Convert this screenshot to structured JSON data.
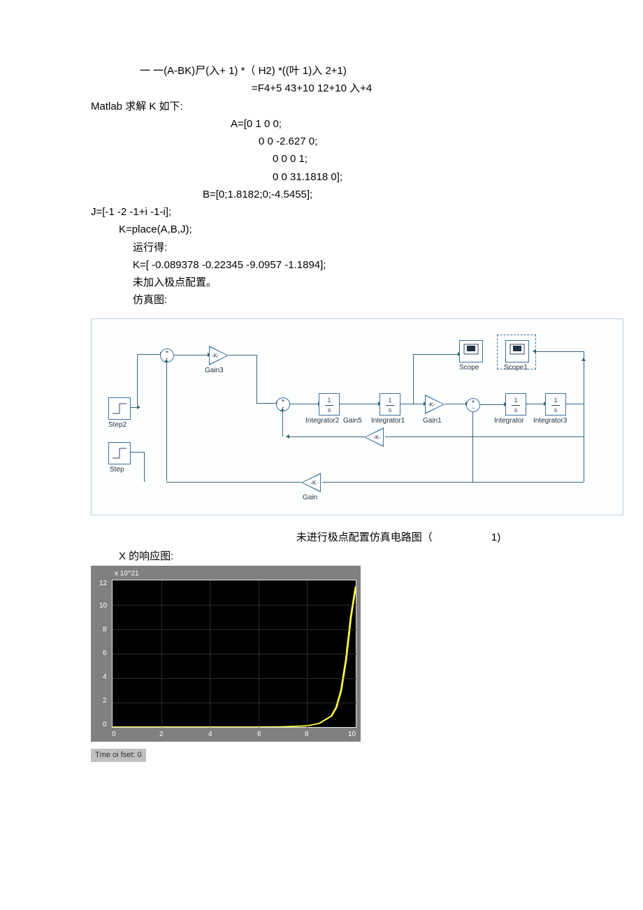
{
  "equations": {
    "line1": "一 一(A-BK)尸(入+ 1) *（ H2) *((叶 1)入 2+1)",
    "line2": "=F4+5 43+10 12+10 入+4"
  },
  "matlab_heading": "Matlab 求解 K 如下:",
  "matlab_lines": {
    "a0": "A=[0     1       0            0;",
    "a1": "0     0 -2.627        0;",
    "a2": "0 0        0          1;",
    "a3": "0 0 31.1818             0];",
    "b": "B=[0;1.8182;0;-4.5455];"
  },
  "j_line": "J=[-1 -2 -1+i     -1-i];",
  "k_line": "K=place(A,B,J);",
  "run_label": "运行得:",
  "k_result": "K=[ -0.089378       -0.22345 -9.0957 -1.1894];",
  "no_pole": "未加入极点配置。",
  "sim_label": "仿真图:",
  "diagram": {
    "step2": "Step2",
    "step": "Step",
    "gain3": "Gain3",
    "integrator2": "Integrator2",
    "gain5": "Gain5",
    "integrator1": "Integrator1",
    "gain1": "Gain1",
    "scope": "Scope",
    "scope1": "Scope1",
    "integrator": "Integrator",
    "integrator3": "Integrator3",
    "gain": "Gain",
    "one_s": "1",
    "s": "s",
    "k": "-K-"
  },
  "caption": {
    "text": "未进行极点配置仿真电路图（",
    "num": "1)"
  },
  "resp_label": "X 的响应图:",
  "chart_data": {
    "type": "line",
    "title": "",
    "xlabel": "",
    "ylabel": "",
    "xlim": [
      0,
      10
    ],
    "ylim": [
      0,
      12
    ],
    "y_exponent": "x 10^21",
    "x_ticks": [
      0,
      2,
      4,
      6,
      8,
      10
    ],
    "y_ticks": [
      0,
      2,
      4,
      6,
      8,
      10,
      12
    ],
    "series": [
      {
        "name": "x",
        "x": [
          0,
          2,
          4,
          6,
          7,
          8,
          8.5,
          9,
          9.2,
          9.4,
          9.6,
          9.8,
          10
        ],
        "y": [
          0,
          0,
          0,
          0,
          0.02,
          0.1,
          0.3,
          0.9,
          1.6,
          3,
          5.5,
          9,
          11.5
        ]
      }
    ]
  },
  "time_offset": "Tme oi fset: 0"
}
